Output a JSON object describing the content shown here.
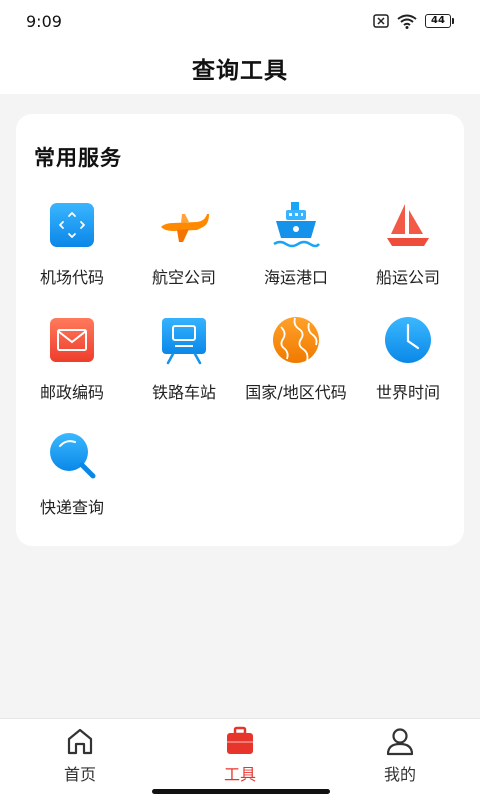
{
  "status_bar": {
    "time": "9:09",
    "battery": "44"
  },
  "header": {
    "title": "查询工具"
  },
  "section": {
    "title": "常用服务"
  },
  "tools": [
    {
      "label": "机场代码",
      "icon": "airport-code-icon"
    },
    {
      "label": "航空公司",
      "icon": "airplane-icon"
    },
    {
      "label": "海运港口",
      "icon": "ship-icon"
    },
    {
      "label": "船运公司",
      "icon": "sailboat-icon"
    },
    {
      "label": "邮政编码",
      "icon": "mail-icon"
    },
    {
      "label": "铁路车站",
      "icon": "train-icon"
    },
    {
      "label": "国家/地区代码",
      "icon": "globe-icon"
    },
    {
      "label": "世界时间",
      "icon": "clock-icon"
    },
    {
      "label": "快递查询",
      "icon": "search-icon"
    }
  ],
  "nav": [
    {
      "label": "首页",
      "icon": "home-icon",
      "active": false
    },
    {
      "label": "工具",
      "icon": "toolbox-icon",
      "active": true
    },
    {
      "label": "我的",
      "icon": "user-icon",
      "active": false
    }
  ],
  "colors": {
    "accent": "#e8352c",
    "background": "#f4f4f4",
    "card": "#ffffff"
  }
}
